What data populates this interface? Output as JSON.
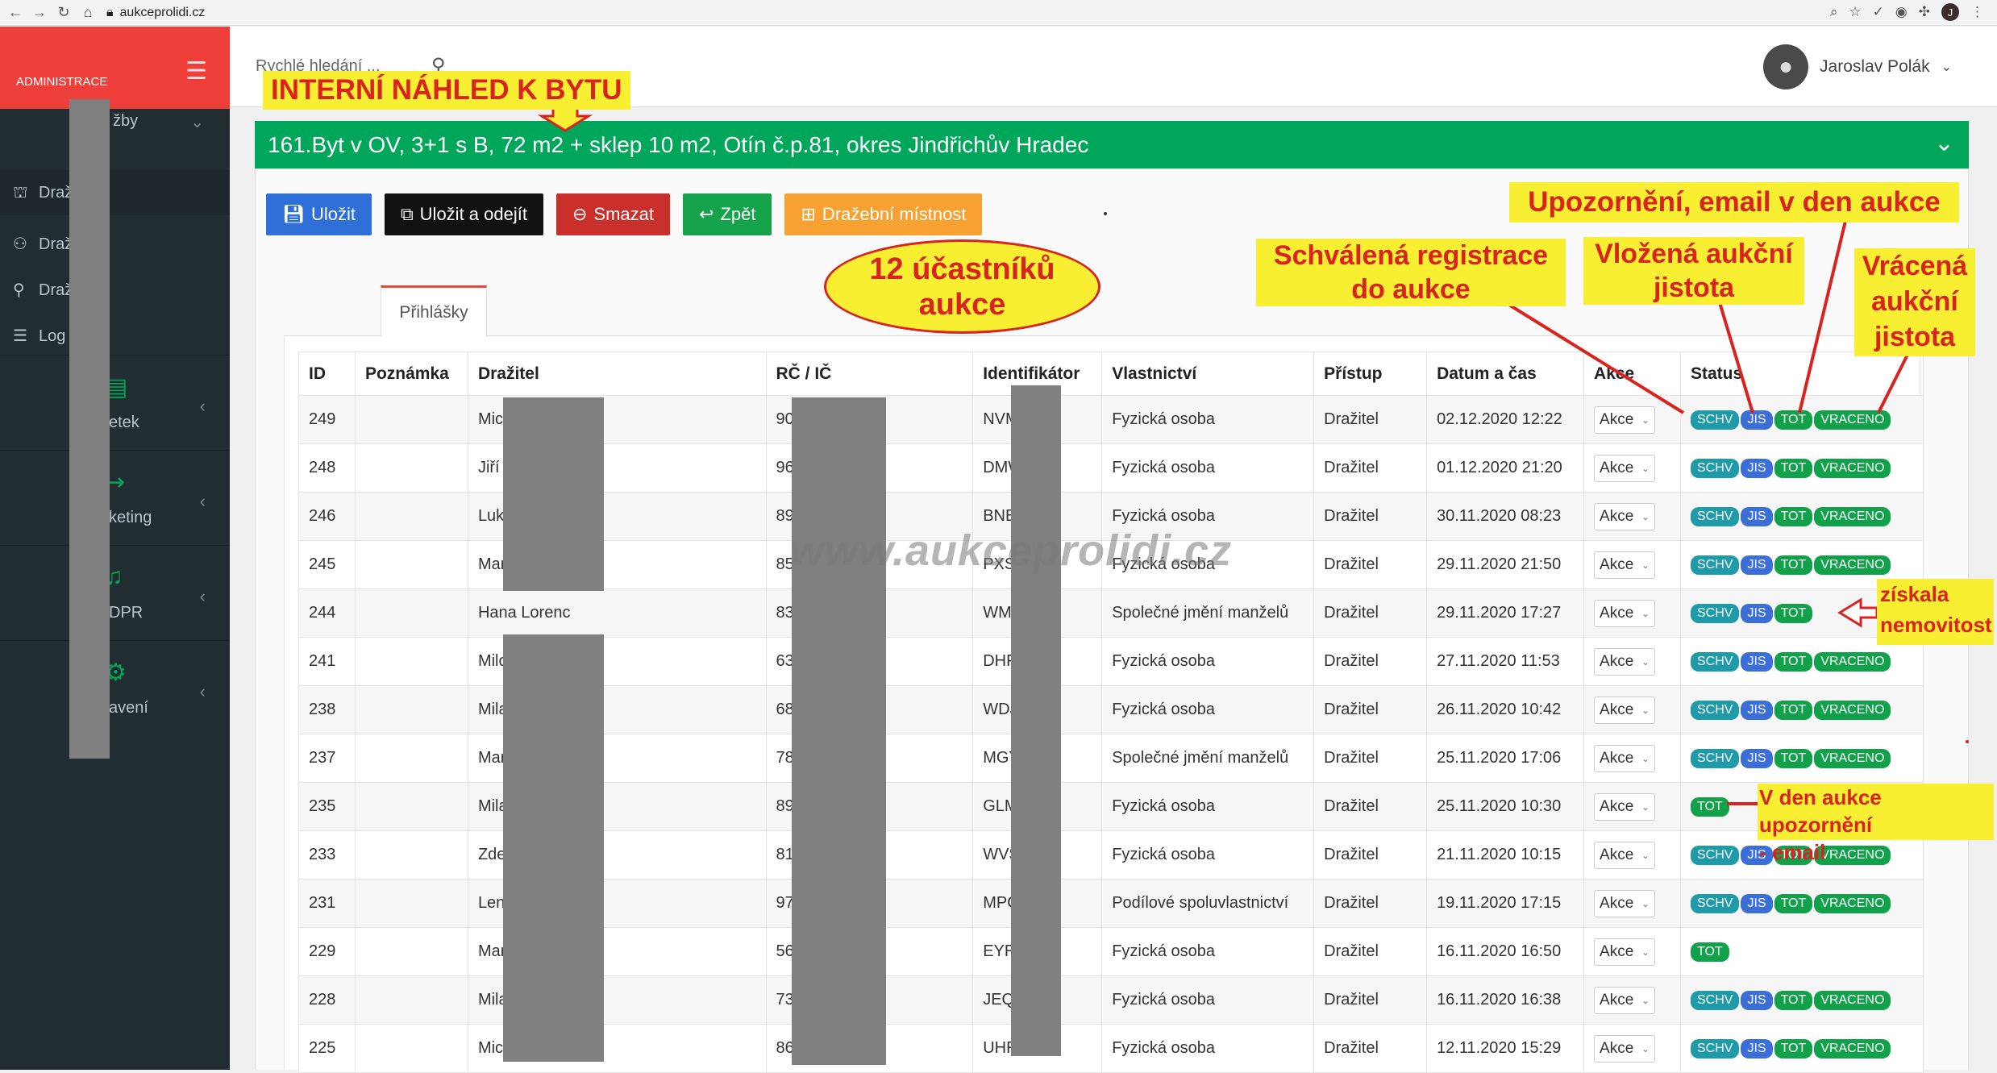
{
  "browser": {
    "url": "aukceprolidi.cz",
    "user_initial": "J"
  },
  "sidebar": {
    "brand_label": "ADMINISTRACE",
    "items": [
      {
        "label": "žby",
        "icon": "chevron-down-icon"
      },
      {
        "label": "Draž",
        "icon": "gavel-icon"
      },
      {
        "label": "Draž",
        "icon": "users-icon"
      },
      {
        "label": "Draž      i",
        "icon": "user-icon"
      },
      {
        "label": "Log      stí",
        "icon": "list-icon"
      }
    ],
    "groups": [
      {
        "label": "etek",
        "icon": "document-icon"
      },
      {
        "label": "keting",
        "icon": "megaphone-icon"
      },
      {
        "label": "DPR",
        "icon": "bell-icon"
      },
      {
        "label": "avení",
        "icon": "gear-icon"
      }
    ]
  },
  "header": {
    "search_placeholder": "Rychlé hledání ...",
    "user_name": "Jaroslav Polák"
  },
  "panel": {
    "title": "161.Byt v OV, 3+1 s B, 72 m2 + sklep 10 m2, Otín č.p.81, okres Jindřichův Hradec"
  },
  "toolbar": {
    "save": "Uložit",
    "save_exit": "Uložit a odejít",
    "delete": "Smazat",
    "back": "Zpět",
    "room": "Dražební místnost"
  },
  "tabs": [
    {
      "label": "Přihlášky"
    }
  ],
  "table": {
    "columns": [
      "ID",
      "Poznámka",
      "Dražitel",
      "RČ / IČ",
      "Identifikátor",
      "Vlastnictví",
      "Přístup",
      "Datum a čas",
      "Akce",
      "Status"
    ],
    "action_label": "Akce",
    "rows": [
      {
        "id": "249",
        "note": "",
        "bidder": "Mich",
        "rc": "901",
        "ident": "NVM",
        "ownership": "Fyzická osoba",
        "access": "Dražitel",
        "datetime": "02.12.2020 12:22",
        "status": [
          "SCHV",
          "JIS",
          "TOT",
          "VRACENO"
        ]
      },
      {
        "id": "248",
        "note": "",
        "bidder": "Jiří F",
        "rc": "960",
        "ident": "DMW",
        "ownership": "Fyzická osoba",
        "access": "Dražitel",
        "datetime": "01.12.2020 21:20",
        "status": [
          "SCHV",
          "JIS",
          "TOT",
          "VRACENO"
        ]
      },
      {
        "id": "246",
        "note": "",
        "bidder": "Luka",
        "rc": "891",
        "ident": "BNB",
        "ownership": "Fyzická osoba",
        "access": "Dražitel",
        "datetime": "30.11.2020 08:23",
        "status": [
          "SCHV",
          "JIS",
          "TOT",
          "VRACENO"
        ]
      },
      {
        "id": "245",
        "note": "",
        "bidder": "Mar",
        "rc": "851",
        "ident": "PXS",
        "ownership": "Fyzická osoba",
        "access": "Dražitel",
        "datetime": "29.11.2020 21:50",
        "status": [
          "SCHV",
          "JIS",
          "TOT",
          "VRACENO"
        ]
      },
      {
        "id": "244",
        "note": "",
        "bidder": "Hana Lorenc",
        "rc": "835",
        "ident": "WME",
        "ownership": "Společné jmění manželů",
        "access": "Dražitel",
        "datetime": "29.11.2020 17:27",
        "status": [
          "SCHV",
          "JIS",
          "TOT"
        ]
      },
      {
        "id": "241",
        "note": "",
        "bidder": "Milo",
        "rc": "630",
        "ident": "DHF",
        "ownership": "Fyzická osoba",
        "access": "Dražitel",
        "datetime": "27.11.2020 11:53",
        "status": [
          "SCHV",
          "JIS",
          "TOT",
          "VRACENO"
        ]
      },
      {
        "id": "238",
        "note": "",
        "bidder": "Mila",
        "rc": "681",
        "ident": "WDJ",
        "ownership": "Fyzická osoba",
        "access": "Dražitel",
        "datetime": "26.11.2020 10:42",
        "status": [
          "SCHV",
          "JIS",
          "TOT",
          "VRACENO"
        ]
      },
      {
        "id": "237",
        "note": "",
        "bidder": "Mar",
        "rc": "786",
        "ident": "MGY",
        "ownership": "Společné jmění manželů",
        "access": "Dražitel",
        "datetime": "25.11.2020 17:06",
        "status": [
          "SCHV",
          "JIS",
          "TOT",
          "VRACENO"
        ]
      },
      {
        "id": "235",
        "note": "",
        "bidder": "Mila",
        "rc": "891",
        "ident": "GLM",
        "ownership": "Fyzická osoba",
        "access": "Dražitel",
        "datetime": "25.11.2020 10:30",
        "status": [
          "TOT"
        ]
      },
      {
        "id": "233",
        "note": "",
        "bidder": "Zden",
        "rc": "810",
        "ident": "WVS",
        "ownership": "Fyzická osoba",
        "access": "Dražitel",
        "datetime": "21.11.2020 10:15",
        "status": [
          "SCHV",
          "JIS",
          "TOT",
          "VRACENO"
        ]
      },
      {
        "id": "231",
        "note": "",
        "bidder": "Lenk",
        "rc": "975",
        "ident": "MPO",
        "ownership": "Podílové spoluvlastnictví",
        "access": "Dražitel",
        "datetime": "19.11.2020 17:15",
        "status": [
          "SCHV",
          "JIS",
          "TOT",
          "VRACENO"
        ]
      },
      {
        "id": "229",
        "note": "",
        "bidder": "Mari",
        "rc": "566",
        "ident": "EYR",
        "ownership": "Fyzická osoba",
        "access": "Dražitel",
        "datetime": "16.11.2020 16:50",
        "status": [
          "TOT"
        ]
      },
      {
        "id": "228",
        "note": "",
        "bidder": "Mila",
        "rc": "730",
        "ident": "JEQ",
        "ownership": "Fyzická osoba",
        "access": "Dražitel",
        "datetime": "16.11.2020 16:38",
        "status": [
          "SCHV",
          "JIS",
          "TOT",
          "VRACENO"
        ]
      },
      {
        "id": "225",
        "note": "",
        "bidder": "Mich",
        "rc": "861",
        "ident": "UHR",
        "ownership": "Fyzická osoba",
        "access": "Dražitel",
        "datetime": "12.11.2020 15:29",
        "status": [
          "SCHV",
          "JIS",
          "TOT",
          "VRACENO"
        ]
      }
    ]
  },
  "annotations": {
    "preview": "INTERNÍ NÁHLED K BYTU",
    "participants_line1": "12 účastníků",
    "participants_line2": "aukce",
    "approved_line1": "Schválená registrace",
    "approved_line2": "do aukce",
    "deposit_line1": "Vložená aukční",
    "deposit_line2": "jistota",
    "notice_email": "Upozornění, email v den aukce",
    "returned_line1": "Vrácená",
    "returned_line2": "aukční",
    "returned_line3": "jistota",
    "won_line1": "získala",
    "won_line2": "nemovitost",
    "day_notice_line1": "V den aukce upozornění",
    "day_notice_line2": "- email",
    "watermark": "www.aukceprolidi.cz"
  },
  "colors": {
    "brand": "#ef3f3a",
    "sidebar": "#222d32",
    "panel_header": "#00a65a",
    "annotation_bg": "#f8ef33",
    "annotation_text": "#d8231f"
  }
}
